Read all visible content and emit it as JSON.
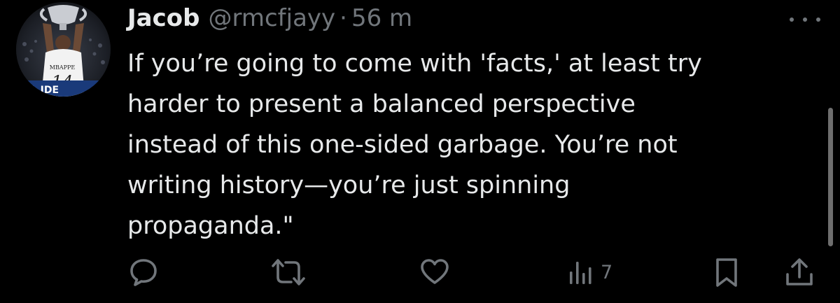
{
  "tweet": {
    "display_name": "Jacob",
    "handle": "@rmcfjayy",
    "separator": "·",
    "time": "56 m",
    "text_lines": [
      "If you’re going to come with 'facts,' at least try",
      "harder to present a balanced perspective",
      "instead of this one-sided garbage. You’re not",
      "writing history—you’re just spinning",
      "propaganda.\""
    ],
    "avatar": {
      "jersey_name": "MBAPPE",
      "jersey_number": "14",
      "banner_text": "AL IDE"
    }
  },
  "actions": {
    "reply_icon": "reply-icon",
    "retweet_icon": "retweet-icon",
    "like_icon": "heart-icon",
    "views_icon": "views-icon",
    "views_count": "7",
    "bookmark_icon": "bookmark-icon",
    "share_icon": "share-icon"
  },
  "colors": {
    "background": "#000000",
    "text_primary": "#e7e9ea",
    "text_secondary": "#71767b"
  }
}
